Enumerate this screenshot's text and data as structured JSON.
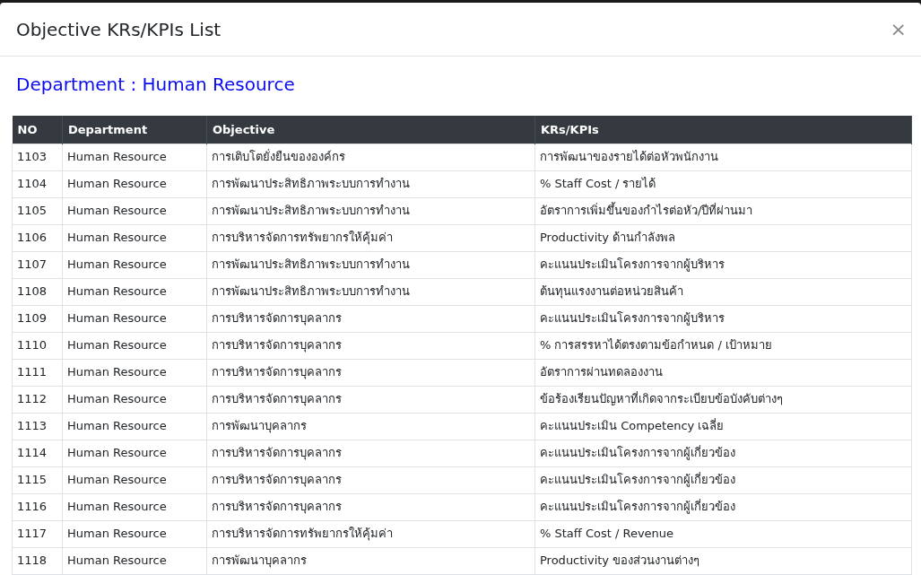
{
  "modal": {
    "title": "Objective KRs/KPIs List",
    "close": "×"
  },
  "heading": "Department : Human Resource",
  "table": {
    "columns": [
      "NO",
      "Department",
      "Objective",
      "KRs/KPIs"
    ],
    "rows": [
      [
        "1103",
        "Human Resource",
        "การเติบโตยั่งยืนขององค์กร",
        "การพัฒนาของรายได้ต่อหัวพนักงาน"
      ],
      [
        "1104",
        "Human Resource",
        "การพัฒนาประสิทธิภาพระบบการทำงาน",
        "% Staff Cost / รายได้"
      ],
      [
        "1105",
        "Human Resource",
        "การพัฒนาประสิทธิภาพระบบการทำงาน",
        "อัตราการเพิ่มขึ้นของกำไรต่อหัว/ปีที่ผ่านมา"
      ],
      [
        "1106",
        "Human Resource",
        "การบริหารจัดการทรัพยากรให้คุ้มค่า",
        "Productivity ด้านกำลังพล"
      ],
      [
        "1107",
        "Human Resource",
        "การพัฒนาประสิทธิภาพระบบการทำงาน",
        "คะแนนประเมินโครงการจากผู้บริหาร"
      ],
      [
        "1108",
        "Human Resource",
        "การพัฒนาประสิทธิภาพระบบการทำงาน",
        "ต้นทุนแรงงานต่อหน่วยสินค้า"
      ],
      [
        "1109",
        "Human Resource",
        "การบริหารจัดการบุคลากร",
        "คะแนนประเมินโครงการจากผู้บริหาร"
      ],
      [
        "1110",
        "Human Resource",
        "การบริหารจัดการบุคลากร",
        "% การสรรหาได้ตรงตามข้อกำหนด / เป้าหมาย"
      ],
      [
        "1111",
        "Human Resource",
        "การบริหารจัดการบุคลากร",
        "อัตราการผ่านทดลองงาน"
      ],
      [
        "1112",
        "Human Resource",
        "การบริหารจัดการบุคลากร",
        "ข้อร้องเรียนปัญหาที่เกิดจากระเบียบข้อบังคับต่างๆ"
      ],
      [
        "1113",
        "Human Resource",
        "การพัฒนาบุคลากร",
        "คะแนนประเมิน Competency เฉลี่ย"
      ],
      [
        "1114",
        "Human Resource",
        "การบริหารจัดการบุคลากร",
        "คะแนนประเมินโครงการจากผู้เกี่ยวข้อง"
      ],
      [
        "1115",
        "Human Resource",
        "การบริหารจัดการบุคลากร",
        "คะแนนประเมินโครงการจากผู้เกี่ยวข้อง"
      ],
      [
        "1116",
        "Human Resource",
        "การบริหารจัดการบุคลากร",
        "คะแนนประเมินโครงการจากผู้เกี่ยวข้อง"
      ],
      [
        "1117",
        "Human Resource",
        "การบริหารจัดการทรัพยากรให้คุ้มค่า",
        "% Staff Cost / Revenue"
      ],
      [
        "1118",
        "Human Resource",
        "การพัฒนาบุคลากร",
        "Productivity ของส่วนงานต่างๆ"
      ]
    ]
  }
}
